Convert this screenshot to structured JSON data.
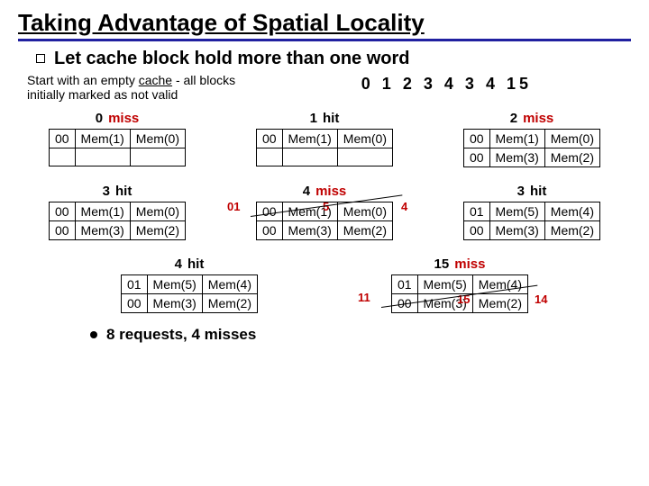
{
  "title": "Taking Advantage of Spatial Locality",
  "bullet": "Let cache block hold more than one word",
  "intro": "Start with an empty cache - all blocks initially marked as not valid",
  "sequence": [
    "0",
    "1",
    "2",
    "3",
    "4",
    "3",
    "4",
    "15"
  ],
  "steps": [
    {
      "n": "0",
      "r": "miss",
      "rc": "red",
      "rows": [
        [
          "00",
          "Mem(1)",
          "Mem(0)"
        ],
        [
          "",
          "",
          ""
        ]
      ]
    },
    {
      "n": "1",
      "r": "hit",
      "rc": "",
      "rows": [
        [
          "00",
          "Mem(1)",
          "Mem(0)"
        ],
        [
          "",
          "",
          ""
        ]
      ]
    },
    {
      "n": "2",
      "r": "miss",
      "rc": "red",
      "rows": [
        [
          "00",
          "Mem(1)",
          "Mem(0)"
        ],
        [
          "00",
          "Mem(3)",
          "Mem(2)"
        ]
      ]
    },
    {
      "n": "3",
      "r": "hit",
      "rc": "",
      "rows": [
        [
          "00",
          "Mem(1)",
          "Mem(0)"
        ],
        [
          "00",
          "Mem(3)",
          "Mem(2)"
        ]
      ]
    },
    {
      "n": "4",
      "r": "miss",
      "rc": "red",
      "rows": [
        [
          "00",
          "Mem(1)",
          "Mem(0)"
        ],
        [
          "00",
          "Mem(3)",
          "Mem(2)"
        ]
      ],
      "overlay": {
        "side": "01",
        "c1": "5",
        "c2": "4"
      }
    },
    {
      "n": "3",
      "r": "hit",
      "rc": "",
      "rows": [
        [
          "01",
          "Mem(5)",
          "Mem(4)"
        ],
        [
          "00",
          "Mem(3)",
          "Mem(2)"
        ]
      ]
    },
    {
      "n": "4",
      "r": "hit",
      "rc": "",
      "rows": [
        [
          "01",
          "Mem(5)",
          "Mem(4)"
        ],
        [
          "00",
          "Mem(3)",
          "Mem(2)"
        ]
      ]
    },
    {
      "n": "15",
      "r": "miss",
      "rc": "red",
      "rows": [
        [
          "01",
          "Mem(5)",
          "Mem(4)"
        ],
        [
          "00",
          "Mem(3)",
          "Mem(2)"
        ]
      ],
      "overlay": {
        "side": "11",
        "c1": "15",
        "c2": "14"
      }
    }
  ],
  "footer": "8 requests, 4 misses"
}
